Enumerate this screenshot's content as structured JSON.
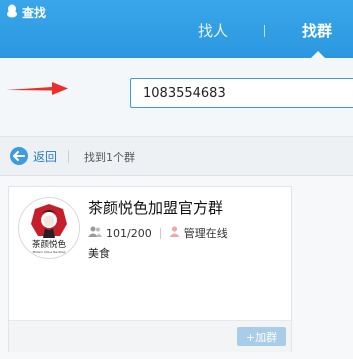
{
  "window": {
    "title": "查找"
  },
  "tabs": {
    "people": "找人",
    "groups": "找群"
  },
  "search": {
    "value": "1083554683"
  },
  "nav": {
    "back_label": "返回",
    "result_count": "找到1个群"
  },
  "results": [
    {
      "name": "茶颜悦色加盟官方群",
      "members": "101/200",
      "admin_status": "管理在线",
      "category": "美食",
      "join_label": "+加群",
      "avatar_text": "茶颜悦色",
      "avatar_subtext": "Modern China Tea Shop"
    }
  ],
  "colors": {
    "accent": "#2f9ee6",
    "arrow": "#e8302c",
    "join": "#a9cde9"
  }
}
